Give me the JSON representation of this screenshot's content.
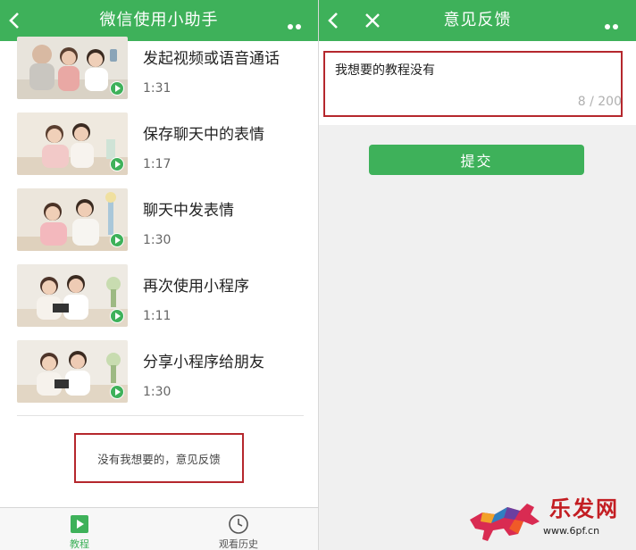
{
  "left": {
    "navbar": {
      "title": "微信使用小助手"
    },
    "videos": [
      {
        "title": "发起视频或语音通话",
        "duration": "1:31"
      },
      {
        "title": "保存聊天中的表情",
        "duration": "1:17"
      },
      {
        "title": "聊天中发表情",
        "duration": "1:30"
      },
      {
        "title": "再次使用小程序",
        "duration": "1:11"
      },
      {
        "title": "分享小程序给朋友",
        "duration": "1:30"
      }
    ],
    "feedback_link": "没有我想要的，意见反馈",
    "tabbar": [
      {
        "label": "教程",
        "icon": "play-video-icon",
        "active": true
      },
      {
        "label": "观看历史",
        "icon": "clock-icon",
        "active": false
      }
    ]
  },
  "right": {
    "navbar": {
      "title": "意见反馈"
    },
    "feedback": {
      "text": "我想要的教程没有",
      "counter": "8 / 200"
    },
    "submit_label": "提交"
  },
  "watermark": {
    "text": "乐发网",
    "url": "www.6pf.cn"
  },
  "colors": {
    "brand_green": "#3eb15a",
    "highlight_red": "#b5272d"
  }
}
